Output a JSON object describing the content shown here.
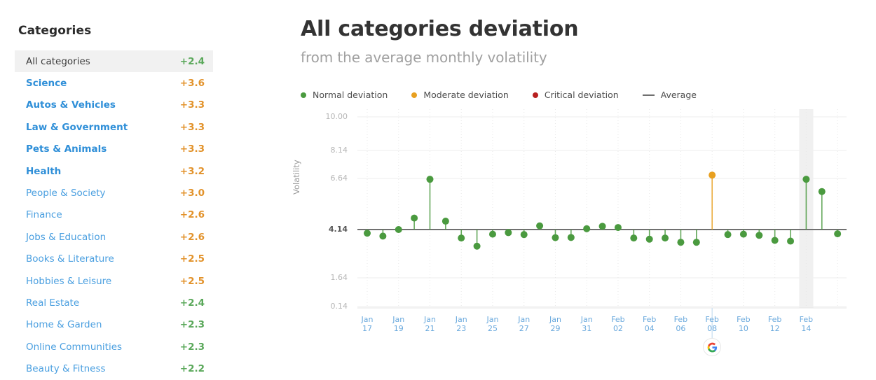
{
  "sidebar": {
    "title": "Categories",
    "items": [
      {
        "label": "All categories",
        "value": "+2.4",
        "value_color": "green",
        "style": "selected"
      },
      {
        "label": "Science",
        "value": "+3.6",
        "value_color": "orange",
        "style": "bold"
      },
      {
        "label": "Autos & Vehicles",
        "value": "+3.3",
        "value_color": "orange",
        "style": "bold"
      },
      {
        "label": "Law & Government",
        "value": "+3.3",
        "value_color": "orange",
        "style": "bold"
      },
      {
        "label": "Pets & Animals",
        "value": "+3.3",
        "value_color": "orange",
        "style": "bold"
      },
      {
        "label": "Health",
        "value": "+3.2",
        "value_color": "orange",
        "style": "bold"
      },
      {
        "label": "People & Society",
        "value": "+3.0",
        "value_color": "orange",
        "style": "plain"
      },
      {
        "label": "Finance",
        "value": "+2.6",
        "value_color": "orange",
        "style": "plain"
      },
      {
        "label": "Jobs & Education",
        "value": "+2.6",
        "value_color": "orange",
        "style": "plain"
      },
      {
        "label": "Books & Literature",
        "value": "+2.5",
        "value_color": "orange",
        "style": "plain"
      },
      {
        "label": "Hobbies & Leisure",
        "value": "+2.5",
        "value_color": "orange",
        "style": "plain"
      },
      {
        "label": "Real Estate",
        "value": "+2.4",
        "value_color": "green",
        "style": "plain"
      },
      {
        "label": "Home & Garden",
        "value": "+2.3",
        "value_color": "green",
        "style": "plain"
      },
      {
        "label": "Online Communities",
        "value": "+2.3",
        "value_color": "green",
        "style": "plain"
      },
      {
        "label": "Beauty & Fitness",
        "value": "+2.2",
        "value_color": "green",
        "style": "plain"
      }
    ]
  },
  "header": {
    "title": "All categories deviation",
    "subtitle": "from the average monthly volatility"
  },
  "colors": {
    "normal": "#4a9a3f",
    "moderate": "#e8a020",
    "critical": "#b82020",
    "average_line": "#707070",
    "category_link": "#4a9fe0",
    "value_green": "#5aa85a",
    "value_orange": "#e2922a"
  },
  "chart_data": {
    "type": "line",
    "title": "All categories deviation",
    "subtitle": "from the average monthly volatility",
    "xlabel": "",
    "ylabel": "Volatility",
    "ylim": [
      0.14,
      10.0
    ],
    "yticks": [
      "0.14",
      "1.64",
      "4.14",
      "6.64",
      "8.14",
      "10.00"
    ],
    "ytick_values": [
      0.14,
      1.64,
      4.14,
      6.64,
      8.14,
      10.0
    ],
    "grid": true,
    "legend_position": "top-left",
    "legend": [
      {
        "label": "Normal deviation",
        "marker": "dot",
        "color": "#4a9a3f"
      },
      {
        "label": "Moderate deviation",
        "marker": "dot",
        "color": "#e8a020"
      },
      {
        "label": "Critical deviation",
        "marker": "dot",
        "color": "#b82020"
      },
      {
        "label": "Average",
        "marker": "line",
        "color": "#707070"
      }
    ],
    "baseline_label": "Average",
    "baseline_value": 4.14,
    "xtick_labels": [
      {
        "month": "Jan",
        "day": "17"
      },
      {
        "month": "Jan",
        "day": "19"
      },
      {
        "month": "Jan",
        "day": "21"
      },
      {
        "month": "Jan",
        "day": "23"
      },
      {
        "month": "Jan",
        "day": "25"
      },
      {
        "month": "Jan",
        "day": "27"
      },
      {
        "month": "Jan",
        "day": "29"
      },
      {
        "month": "Jan",
        "day": "31"
      },
      {
        "month": "Feb",
        "day": "02"
      },
      {
        "month": "Feb",
        "day": "04"
      },
      {
        "month": "Feb",
        "day": "06"
      },
      {
        "month": "Feb",
        "day": "08"
      },
      {
        "month": "Feb",
        "day": "10"
      },
      {
        "month": "Feb",
        "day": "12"
      },
      {
        "month": "Feb",
        "day": "14"
      }
    ],
    "points": [
      {
        "x": "Jan 17",
        "y": 3.95,
        "status": "normal"
      },
      {
        "x": "Jan 18",
        "y": 3.8,
        "status": "normal"
      },
      {
        "x": "Jan 19",
        "y": 4.14,
        "status": "normal"
      },
      {
        "x": "Jan 20",
        "y": 4.7,
        "status": "normal"
      },
      {
        "x": "Jan 21",
        "y": 6.6,
        "status": "normal"
      },
      {
        "x": "Jan 22",
        "y": 4.55,
        "status": "normal"
      },
      {
        "x": "Jan 23",
        "y": 3.7,
        "status": "normal"
      },
      {
        "x": "Jan 24",
        "y": 3.28,
        "status": "normal"
      },
      {
        "x": "Jan 25",
        "y": 3.9,
        "status": "normal"
      },
      {
        "x": "Jan 26",
        "y": 3.98,
        "status": "normal"
      },
      {
        "x": "Jan 27",
        "y": 3.88,
        "status": "normal"
      },
      {
        "x": "Jan 28",
        "y": 4.32,
        "status": "normal"
      },
      {
        "x": "Jan 29",
        "y": 3.72,
        "status": "normal"
      },
      {
        "x": "Jan 30",
        "y": 3.73,
        "status": "normal"
      },
      {
        "x": "Jan 31",
        "y": 4.18,
        "status": "normal"
      },
      {
        "x": "Feb 01",
        "y": 4.3,
        "status": "normal"
      },
      {
        "x": "Feb 02",
        "y": 4.24,
        "status": "normal"
      },
      {
        "x": "Feb 03",
        "y": 3.7,
        "status": "normal"
      },
      {
        "x": "Feb 04",
        "y": 3.64,
        "status": "normal"
      },
      {
        "x": "Feb 05",
        "y": 3.7,
        "status": "normal"
      },
      {
        "x": "Feb 06",
        "y": 3.48,
        "status": "normal"
      },
      {
        "x": "Feb 07",
        "y": 3.48,
        "status": "normal"
      },
      {
        "x": "Feb 08",
        "y": 6.82,
        "status": "moderate"
      },
      {
        "x": "Feb 09",
        "y": 3.88,
        "status": "normal"
      },
      {
        "x": "Feb 10",
        "y": 3.9,
        "status": "normal"
      },
      {
        "x": "Feb 11",
        "y": 3.84,
        "status": "normal"
      },
      {
        "x": "Feb 12",
        "y": 3.58,
        "status": "normal"
      },
      {
        "x": "Feb 13",
        "y": 3.54,
        "status": "normal"
      },
      {
        "x": "Feb 14",
        "y": 6.6,
        "status": "normal"
      },
      {
        "x": "Feb 15",
        "y": 6.0,
        "status": "normal"
      },
      {
        "x": "Feb 16",
        "y": 3.92,
        "status": "normal"
      }
    ],
    "highlight_band": {
      "from": "Feb 14",
      "to": "Feb 14"
    },
    "annotation_marker": {
      "name": "google-logo",
      "x": "Feb 08"
    }
  }
}
